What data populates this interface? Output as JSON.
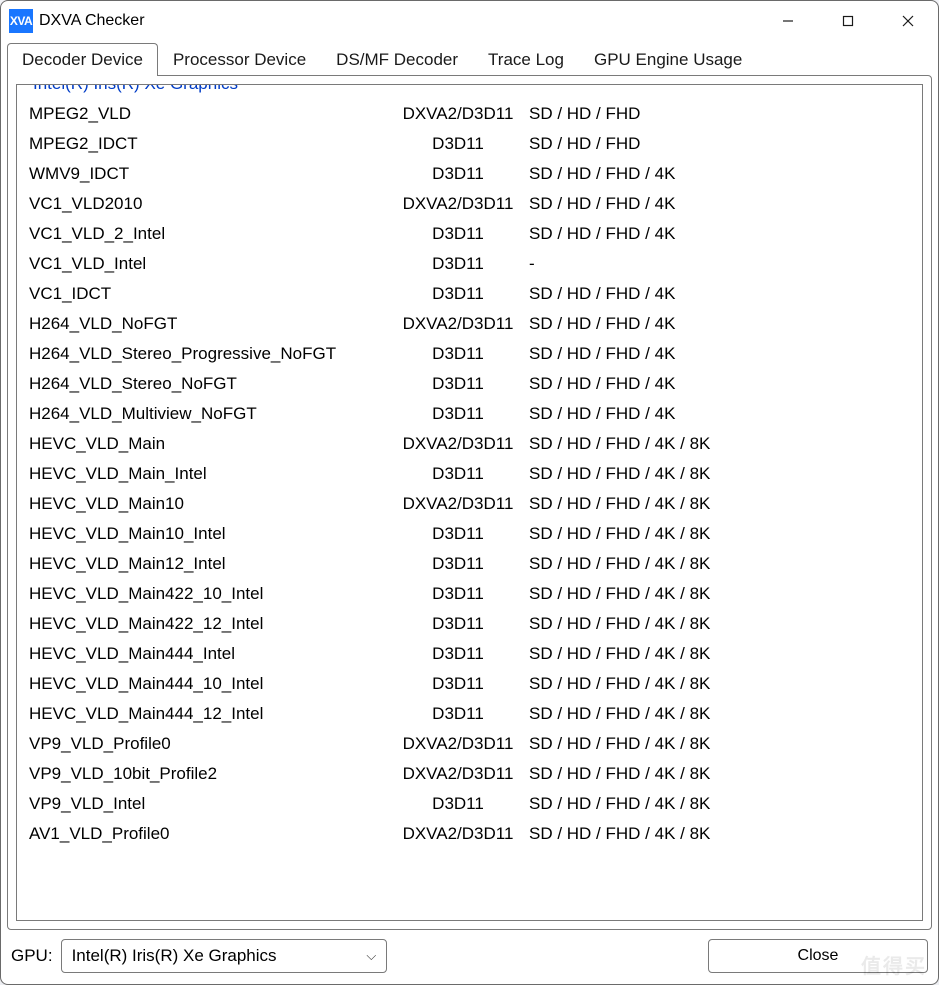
{
  "app": {
    "icon_text": "XVA",
    "title": "DXVA Checker"
  },
  "tabs": [
    "Decoder Device",
    "Processor Device",
    "DS/MF Decoder",
    "Trace Log",
    "GPU Engine Usage"
  ],
  "active_tab_index": 0,
  "group": {
    "legend": "Intel(R) Iris(R) Xe Graphics"
  },
  "codecs": [
    {
      "name": "MPEG2_VLD",
      "api": "DXVA2/D3D11",
      "res": "SD / HD / FHD"
    },
    {
      "name": "MPEG2_IDCT",
      "api": "D3D11",
      "res": "SD / HD / FHD"
    },
    {
      "name": "WMV9_IDCT",
      "api": "D3D11",
      "res": "SD / HD / FHD / 4K"
    },
    {
      "name": "VC1_VLD2010",
      "api": "DXVA2/D3D11",
      "res": "SD / HD / FHD / 4K"
    },
    {
      "name": "VC1_VLD_2_Intel",
      "api": "D3D11",
      "res": "SD / HD / FHD / 4K"
    },
    {
      "name": "VC1_VLD_Intel",
      "api": "D3D11",
      "res": "-"
    },
    {
      "name": "VC1_IDCT",
      "api": "D3D11",
      "res": "SD / HD / FHD / 4K"
    },
    {
      "name": "H264_VLD_NoFGT",
      "api": "DXVA2/D3D11",
      "res": "SD / HD / FHD / 4K"
    },
    {
      "name": "H264_VLD_Stereo_Progressive_NoFGT",
      "api": "D3D11",
      "res": "SD / HD / FHD / 4K"
    },
    {
      "name": "H264_VLD_Stereo_NoFGT",
      "api": "D3D11",
      "res": "SD / HD / FHD / 4K"
    },
    {
      "name": "H264_VLD_Multiview_NoFGT",
      "api": "D3D11",
      "res": "SD / HD / FHD / 4K"
    },
    {
      "name": "HEVC_VLD_Main",
      "api": "DXVA2/D3D11",
      "res": "SD / HD / FHD / 4K / 8K"
    },
    {
      "name": "HEVC_VLD_Main_Intel",
      "api": "D3D11",
      "res": "SD / HD / FHD / 4K / 8K"
    },
    {
      "name": "HEVC_VLD_Main10",
      "api": "DXVA2/D3D11",
      "res": "SD / HD / FHD / 4K / 8K"
    },
    {
      "name": "HEVC_VLD_Main10_Intel",
      "api": "D3D11",
      "res": "SD / HD / FHD / 4K / 8K"
    },
    {
      "name": "HEVC_VLD_Main12_Intel",
      "api": "D3D11",
      "res": "SD / HD / FHD / 4K / 8K"
    },
    {
      "name": "HEVC_VLD_Main422_10_Intel",
      "api": "D3D11",
      "res": "SD / HD / FHD / 4K / 8K"
    },
    {
      "name": "HEVC_VLD_Main422_12_Intel",
      "api": "D3D11",
      "res": "SD / HD / FHD / 4K / 8K"
    },
    {
      "name": "HEVC_VLD_Main444_Intel",
      "api": "D3D11",
      "res": "SD / HD / FHD / 4K / 8K"
    },
    {
      "name": "HEVC_VLD_Main444_10_Intel",
      "api": "D3D11",
      "res": "SD / HD / FHD / 4K / 8K"
    },
    {
      "name": "HEVC_VLD_Main444_12_Intel",
      "api": "D3D11",
      "res": "SD / HD / FHD / 4K / 8K"
    },
    {
      "name": "VP9_VLD_Profile0",
      "api": "DXVA2/D3D11",
      "res": "SD / HD / FHD / 4K / 8K"
    },
    {
      "name": "VP9_VLD_10bit_Profile2",
      "api": "DXVA2/D3D11",
      "res": "SD / HD / FHD / 4K / 8K"
    },
    {
      "name": "VP9_VLD_Intel",
      "api": "D3D11",
      "res": "SD / HD / FHD / 4K / 8K"
    },
    {
      "name": "AV1_VLD_Profile0",
      "api": "DXVA2/D3D11",
      "res": "SD / HD / FHD / 4K / 8K"
    }
  ],
  "bottom": {
    "gpu_label": "GPU:",
    "gpu_selected": "Intel(R) Iris(R) Xe Graphics",
    "close_label": "Close"
  },
  "watermark": "值得买"
}
